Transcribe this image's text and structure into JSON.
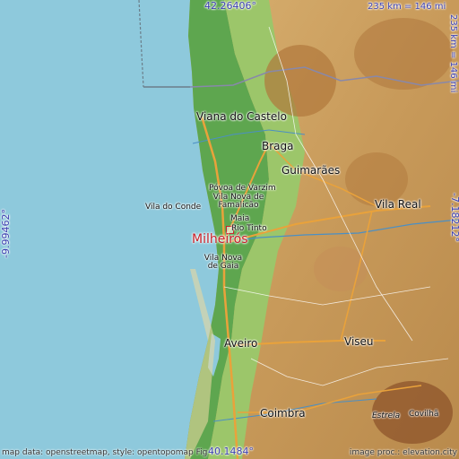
{
  "map": {
    "coords": {
      "north": "42.26406°",
      "south": "40.1484°",
      "west": "-9.99462°",
      "east": "-7.18212°"
    },
    "scale_top": "235 km = 146 mi",
    "scale_right": "235 km = 146 mi",
    "highlight": "Milheirós",
    "cities": [
      {
        "name": "Viana do Castelo"
      },
      {
        "name": "Braga"
      },
      {
        "name": "Guimarães"
      },
      {
        "name": "Póvoa de Varzim"
      },
      {
        "name": "Vila Nova de Famalicão"
      },
      {
        "name": "Vila do Conde"
      },
      {
        "name": "Maia"
      },
      {
        "name": "Rio Tinto"
      },
      {
        "name": "Vila Nova de Gaia"
      },
      {
        "name": "Vila Real"
      },
      {
        "name": "Aveiro"
      },
      {
        "name": "Viseu"
      },
      {
        "name": "Coimbra"
      },
      {
        "name": "Estrela"
      },
      {
        "name": "Covilhã"
      }
    ],
    "attribution_left": "map data: openstreetmap, style: opentopomap Fig",
    "attribution_right": "image proc.: elevation.city"
  }
}
